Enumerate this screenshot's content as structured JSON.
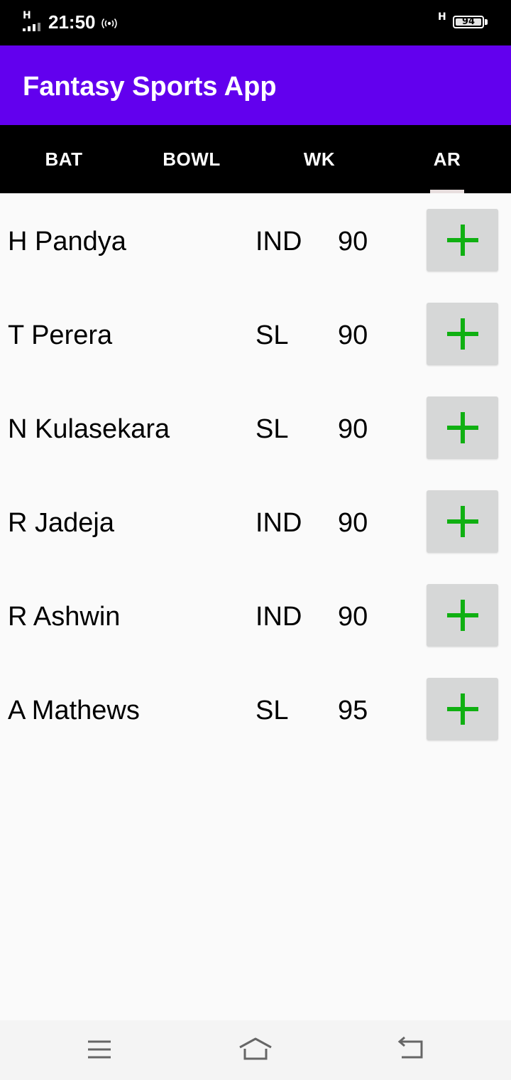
{
  "status_bar": {
    "network_type_left": "H",
    "time": "21:50",
    "network_type_right": "H",
    "battery_level": "94",
    "icons": [
      "signal-icon",
      "hotspot-icon",
      "battery-icon"
    ]
  },
  "app_bar": {
    "title": "Fantasy Sports App",
    "color": "#6200ee"
  },
  "tabs": [
    {
      "label": "BAT",
      "selected": false
    },
    {
      "label": "BOWL",
      "selected": false
    },
    {
      "label": "WK",
      "selected": false
    },
    {
      "label": "AR",
      "selected": true
    }
  ],
  "players": [
    {
      "name": "H Pandya",
      "team": "IND",
      "points": "90"
    },
    {
      "name": "T Perera",
      "team": "SL",
      "points": "90"
    },
    {
      "name": "N Kulasekara",
      "team": "SL",
      "points": "90"
    },
    {
      "name": "R Jadeja",
      "team": "IND",
      "points": "90"
    },
    {
      "name": "R Ashwin",
      "team": "IND",
      "points": "90"
    },
    {
      "name": "A Mathews",
      "team": "SL",
      "points": "95"
    }
  ],
  "add_button": {
    "icon": "plus-icon",
    "icon_color": "#10b012",
    "background": "#d6d7d7"
  },
  "nav_bar": {
    "icons": [
      "menu-icon",
      "home-icon",
      "back-icon"
    ]
  }
}
